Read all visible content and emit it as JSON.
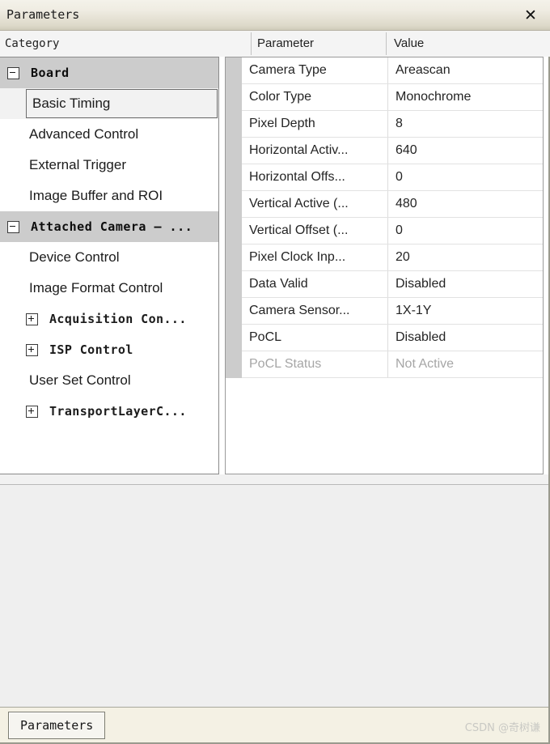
{
  "window": {
    "title": "Parameters",
    "close_label": "✕"
  },
  "headers": {
    "category": "Category",
    "parameter": "Parameter",
    "value": "Value"
  },
  "tree": {
    "nodes": [
      {
        "type": "group",
        "label": "Board",
        "expander": "minus"
      },
      {
        "type": "item",
        "label": "Basic Timing",
        "selected": true
      },
      {
        "type": "item",
        "label": "Advanced Control",
        "selected": false
      },
      {
        "type": "item",
        "label": "External Trigger",
        "selected": false
      },
      {
        "type": "item",
        "label": "Image Buffer and ROI",
        "selected": false
      },
      {
        "type": "group",
        "label": "Attached Camera — ...",
        "expander": "minus"
      },
      {
        "type": "item",
        "label": "Device Control",
        "selected": false
      },
      {
        "type": "item",
        "label": "Image Format Control",
        "selected": false
      },
      {
        "type": "item-mono",
        "label": "Acquisition Con...",
        "expander": "plus"
      },
      {
        "type": "item-mono",
        "label": "ISP Control",
        "expander": "plus"
      },
      {
        "type": "item",
        "label": "User Set Control",
        "selected": false
      },
      {
        "type": "item-mono",
        "label": "TransportLayerC...",
        "expander": "plus"
      }
    ]
  },
  "table": {
    "rows": [
      {
        "name": "Camera Type",
        "value": "Areascan",
        "disabled": false
      },
      {
        "name": "Color Type",
        "value": "Monochrome",
        "disabled": false
      },
      {
        "name": "Pixel Depth",
        "value": "8",
        "disabled": false
      },
      {
        "name": "Horizontal Activ...",
        "value": "640",
        "disabled": false
      },
      {
        "name": "Horizontal Offs...",
        "value": "0",
        "disabled": false
      },
      {
        "name": "Vertical Active (...",
        "value": "480",
        "disabled": false
      },
      {
        "name": "Vertical Offset (...",
        "value": "0",
        "disabled": false
      },
      {
        "name": "Pixel Clock Inp...",
        "value": "20",
        "disabled": false
      },
      {
        "name": "Data Valid",
        "value": "Disabled",
        "disabled": false
      },
      {
        "name": "Camera Sensor...",
        "value": "1X-1Y",
        "disabled": false
      },
      {
        "name": "PoCL",
        "value": "Disabled",
        "disabled": false
      },
      {
        "name": "PoCL Status",
        "value": "Not Active",
        "disabled": true
      }
    ]
  },
  "tabs": {
    "items": [
      {
        "label": "Parameters",
        "active": true
      }
    ]
  },
  "watermark": {
    "text": "CSDN @奇树谦"
  },
  "colors": {
    "titlebar_top": "#f4f2ea",
    "titlebar_bottom": "#cfcbba",
    "group_row": "#cccccc",
    "selection": "#f2f2f2",
    "gutter": "#cccccc",
    "disabled_text": "#a6a6a6",
    "tabstrip": "#f4f1e4",
    "lower_area": "#efefef"
  }
}
